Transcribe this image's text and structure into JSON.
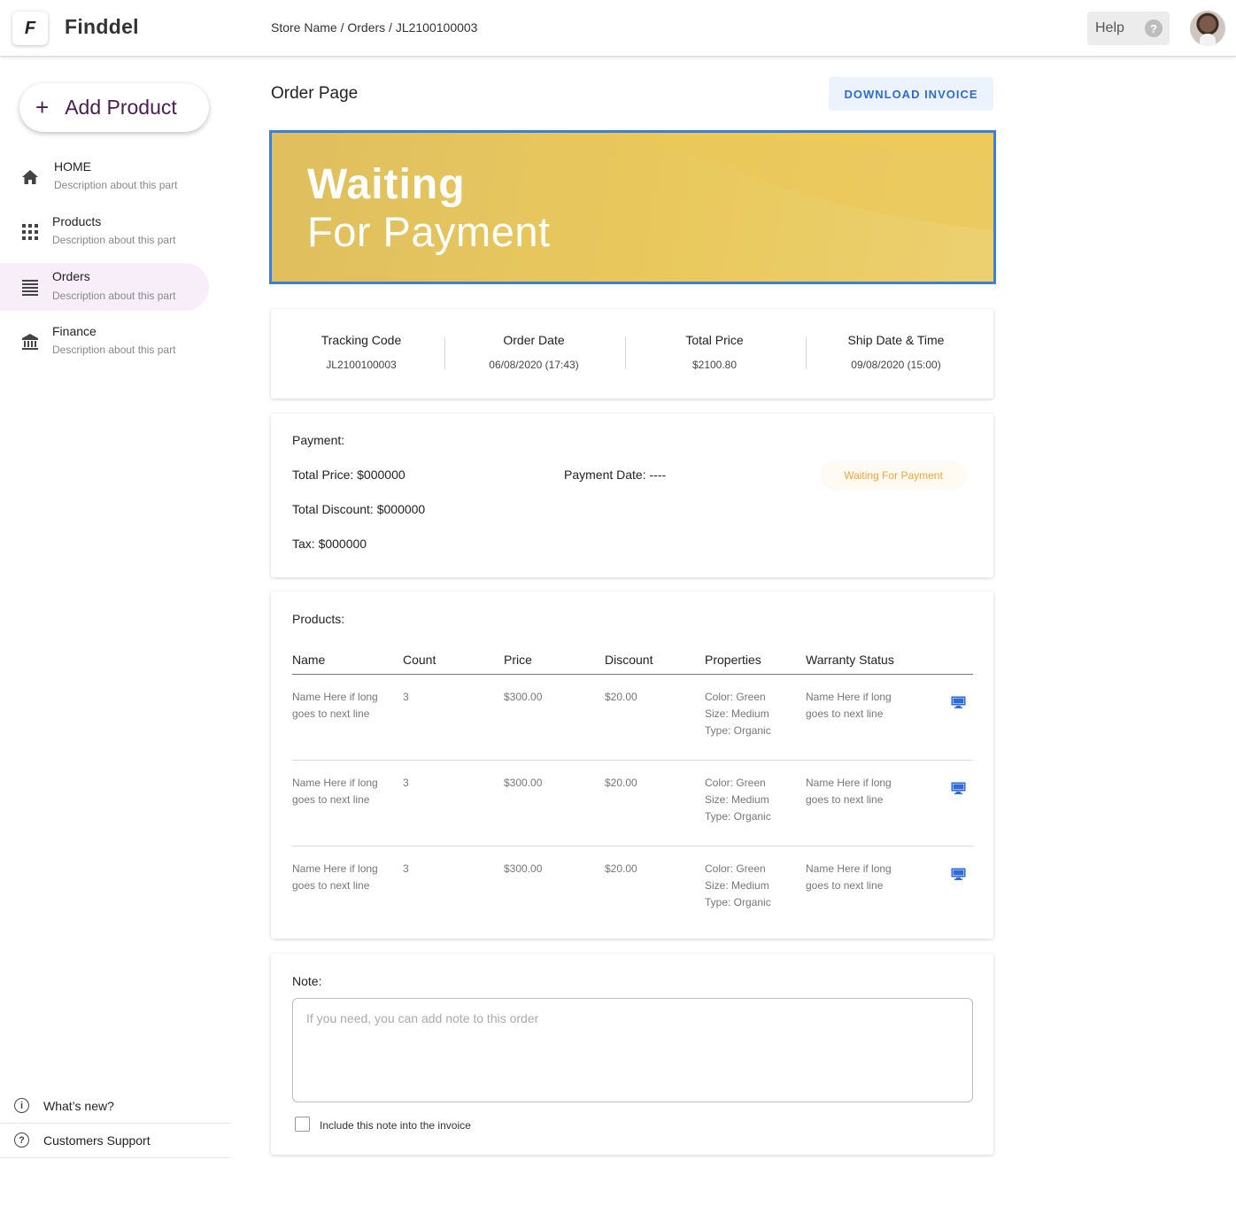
{
  "header": {
    "logo_letter": "F",
    "brand": "Finddel",
    "breadcrumb": "Store Name / Orders / JL2100100003",
    "help_label": "Help",
    "help_icon": "?"
  },
  "sidebar": {
    "add_product_label": "Add Product",
    "add_icon": "+",
    "items": [
      {
        "title": "HOME",
        "desc": "Description about this part",
        "icon": "home-icon"
      },
      {
        "title": "Products",
        "desc": "Description about this part",
        "icon": "grid-icon"
      },
      {
        "title": "Orders",
        "desc": "Description about this part",
        "icon": "list-icon",
        "active": true
      },
      {
        "title": "Finance",
        "desc": "Description about this part",
        "icon": "bank-icon"
      }
    ],
    "footer": [
      {
        "label": "What’s new?",
        "icon": "info-icon",
        "glyph": "i"
      },
      {
        "label": "Customers Support",
        "icon": "help-icon",
        "glyph": "?"
      }
    ]
  },
  "main": {
    "page_title": "Order Page",
    "download_label": "DOWNLOAD INVOICE",
    "banner": {
      "line1": "Waiting",
      "line2": "For Payment"
    },
    "summary": [
      {
        "label": "Tracking Code",
        "value": "JL2100100003"
      },
      {
        "label": "Order Date",
        "value": "06/08/2020 (17:43)"
      },
      {
        "label": "Total Price",
        "value": "$2100.80"
      },
      {
        "label": "Ship Date & Time",
        "value": "09/08/2020 (15:00)"
      }
    ],
    "payment": {
      "label": "Payment:",
      "total_price": "Total Price: $000000",
      "payment_date": "Payment Date: ----",
      "total_discount": "Total Discount: $000000",
      "tax": "Tax: $000000",
      "status": "Waiting For Payment"
    },
    "products": {
      "label": "Products:",
      "columns": [
        "Name",
        "Count",
        "Price",
        "Discount",
        "Properties",
        "Warranty Status"
      ],
      "rows": [
        {
          "name": [
            "Name Here if long",
            "goes to next line"
          ],
          "count": "3",
          "price": "$300.00",
          "discount": "$20.00",
          "properties": [
            "Color: Green",
            "Size: Medium",
            "Type: Organic"
          ],
          "warranty": [
            "Name Here if long",
            "goes to next line"
          ]
        },
        {
          "name": [
            "Name Here if long",
            "goes to next line"
          ],
          "count": "3",
          "price": "$300.00",
          "discount": "$20.00",
          "properties": [
            "Color: Green",
            "Size: Medium",
            "Type: Organic"
          ],
          "warranty": [
            "Name Here if long",
            "goes to next line"
          ]
        },
        {
          "name": [
            "Name Here if long",
            "goes to next line"
          ],
          "count": "3",
          "price": "$300.00",
          "discount": "$20.00",
          "properties": [
            "Color: Green",
            "Size: Medium",
            "Type: Organic"
          ],
          "warranty": [
            "Name Here if long",
            "goes to next line"
          ]
        }
      ]
    },
    "note": {
      "label": "Note:",
      "placeholder": "If you need, you can add note to this order",
      "checkbox_label": "Include this note into the invoice"
    }
  },
  "colors": {
    "accent_blue": "#2e6bd6",
    "brand_purple": "#4a1d4f",
    "banner_yellow": "#e9c95d",
    "status_orange": "#f2a53a"
  }
}
